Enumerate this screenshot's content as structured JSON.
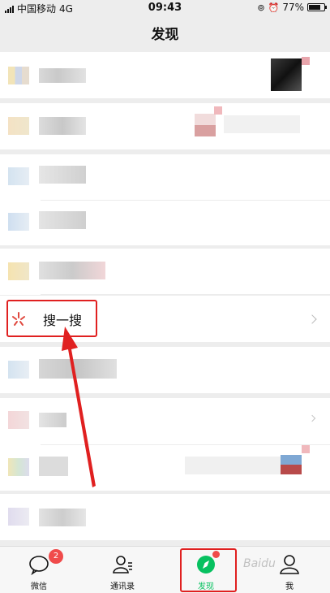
{
  "status_bar": {
    "carrier": "中国移动",
    "network": "4G",
    "time": "09:43",
    "battery": "77%",
    "battery_level": 0.77
  },
  "nav": {
    "title": "发现"
  },
  "search_row": {
    "label": "搜一搜"
  },
  "tabs": [
    {
      "label": "微信",
      "icon": "chat-icon",
      "badge": "2"
    },
    {
      "label": "通讯录",
      "icon": "contacts-icon"
    },
    {
      "label": "发现",
      "icon": "compass-icon",
      "active": true
    },
    {
      "label": "我",
      "icon": "profile-icon"
    }
  ],
  "watermark": "Baidu",
  "colors": {
    "accent": "#07c160",
    "annotation_red": "#e02020",
    "badge_red": "#f04b4b",
    "background": "#ededed"
  }
}
